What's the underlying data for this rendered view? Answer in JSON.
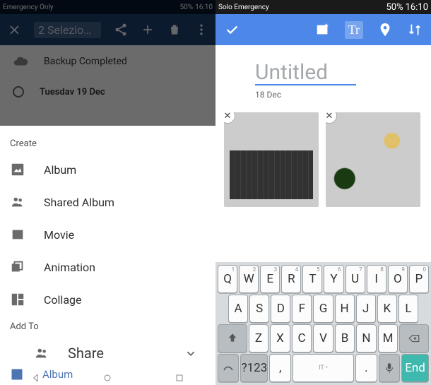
{
  "left": {
    "status": {
      "carrier": "Emergency Only",
      "battery": "50%",
      "time": "16:10"
    },
    "topbar": {
      "title": "2 Selezio…"
    },
    "backup_row": "Backup Completed",
    "date_row": "Tuesdav 19 Dec",
    "sheet": {
      "create_hdr": "Create",
      "options": [
        {
          "label": "Album"
        },
        {
          "label": "Shared Album"
        },
        {
          "label": "Movie"
        },
        {
          "label": "Animation"
        },
        {
          "label": "Collage"
        }
      ],
      "addto_hdr": "Add To",
      "share": "Share",
      "bottom": "Album"
    }
  },
  "right": {
    "status": {
      "carrier": "Solo Emergency",
      "battery": "50%",
      "time": "16:10"
    },
    "title": "Untitled",
    "date": "18 Dec",
    "topbar": {
      "tr": "Tr"
    },
    "keyboard": {
      "r1": [
        {
          "k": "Q",
          "n": "1"
        },
        {
          "k": "W",
          "n": "2"
        },
        {
          "k": "E",
          "n": "3"
        },
        {
          "k": "R",
          "n": "4"
        },
        {
          "k": "T",
          "n": "5"
        },
        {
          "k": "Y",
          "n": "6"
        },
        {
          "k": "U",
          "n": "7"
        },
        {
          "k": "I",
          "n": "8"
        },
        {
          "k": "O",
          "n": "9"
        },
        {
          "k": "P",
          "n": "0"
        }
      ],
      "r2": [
        {
          "k": "A"
        },
        {
          "k": "S"
        },
        {
          "k": "D"
        },
        {
          "k": "F"
        },
        {
          "k": "G"
        },
        {
          "k": "H"
        },
        {
          "k": "J"
        },
        {
          "k": "K"
        },
        {
          "k": "L"
        }
      ],
      "r3": [
        {
          "k": "Z"
        },
        {
          "k": "X"
        },
        {
          "k": "C"
        },
        {
          "k": "V"
        },
        {
          "k": "B"
        },
        {
          "k": "N"
        },
        {
          "k": "M"
        }
      ],
      "r4": {
        "sym": "?123",
        "comma": ",",
        "space": "IT •",
        "dot": ".",
        "end": "End"
      }
    }
  }
}
